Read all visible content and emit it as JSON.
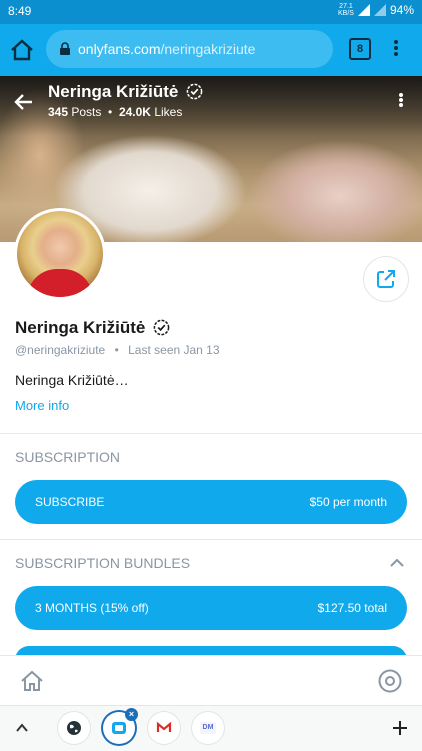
{
  "status_bar": {
    "time": "8:49",
    "net_speed_value": "27.1",
    "net_speed_unit": "KB/S",
    "battery": "94%"
  },
  "browser": {
    "url_domain": "onlyfans.com",
    "url_path": "/neringakriziute",
    "tab_count": "8"
  },
  "profile": {
    "name": "Neringa Križiūtė",
    "posts_count": "345",
    "posts_label": "Posts",
    "likes_count": "24.0K",
    "likes_label": "Likes",
    "handle": "@neringakriziute",
    "last_seen": "Last seen Jan 13",
    "bio": "Neringa Križiūtė…",
    "more_info": "More info"
  },
  "subscription": {
    "title": "SUBSCRIPTION",
    "button_label": "SUBSCRIBE",
    "button_price": "$50 per month"
  },
  "bundles": {
    "title": "SUBSCRIPTION BUNDLES",
    "items": [
      {
        "label": "3 MONTHS (15% off)",
        "price": "$127.50 total"
      }
    ]
  },
  "colors": {
    "accent": "#0fa9ec",
    "status_bar": "#0b8fce",
    "muted_text": "#8a96a3",
    "avatar_top": "#d21f2a"
  },
  "icons": {
    "browser": [
      "home-icon",
      "lock-icon",
      "tabs-icon",
      "more-vert-icon"
    ],
    "cover": [
      "back-arrow-icon",
      "verified-icon",
      "more-vert-icon"
    ],
    "profile": [
      "share-icon",
      "verified-icon",
      "chevron-up-icon"
    ],
    "app_nav": [
      "home-icon",
      "profile-icon"
    ],
    "tab_bar": [
      "chevron-up-icon",
      "globe-icon",
      "onlyfans-tab-icon",
      "gmail-icon",
      "dm-icon",
      "plus-icon"
    ]
  },
  "tab_bar": {
    "dm_label": "DM",
    "close_glyph": "×"
  }
}
